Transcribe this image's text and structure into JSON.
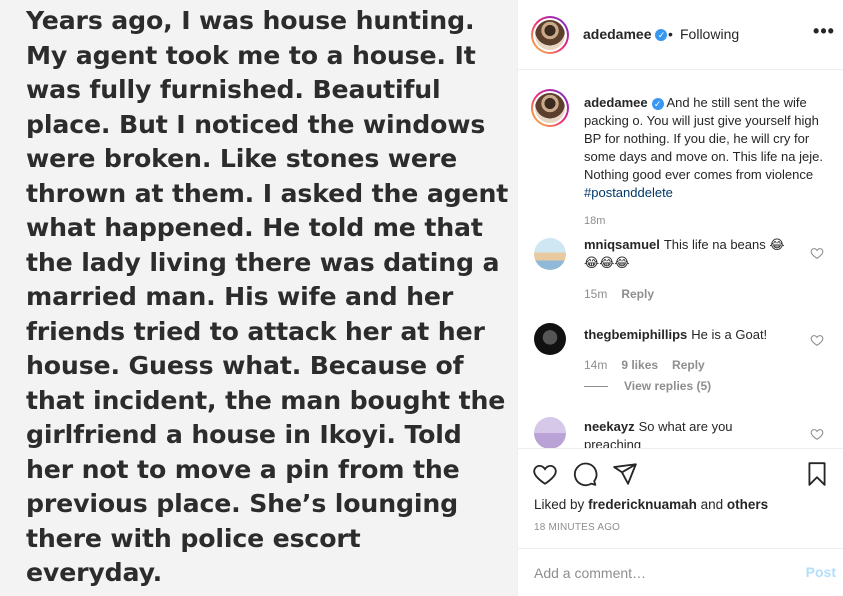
{
  "post_image": {
    "lines": [
      "Years ago, I was house hunting.",
      "My agent took me to a house. It",
      "was fully furnished. Beautiful",
      "place. But I noticed the windows",
      "were broken. Like stones were",
      "thrown at them. I asked the agent",
      "what happened. He told me that",
      "the lady living there was dating a",
      "married man. His wife and her",
      "friends tried to attack her at her",
      "house. Guess what. Because of",
      "that incident, the man bought the",
      "girlfriend a house in Ikoyi. Told",
      "her not to move a pin from the",
      "previous place. She’s lounging",
      "there with police escort",
      "everyday."
    ]
  },
  "header": {
    "username": "adedamee",
    "separator": "•",
    "follow_status": "Following",
    "more_icon": "more-horizontal-icon"
  },
  "caption": {
    "username": "adedamee",
    "text": "And he still sent the wife packing o. You will just give yourself high BP for nothing. If you die, he will cry for some days and move on. This life na jeje. Nothing good ever comes from violence",
    "hashtag": "#postanddelete",
    "time": "18m"
  },
  "comments": [
    {
      "username": "mniqsamuel",
      "text": "This life na beans 😂",
      "text_line2": "😂😂😂",
      "time": "15m",
      "likes": "",
      "reply": "Reply"
    },
    {
      "username": "thegbemiphillips",
      "text": "He is a Goat!",
      "time": "14m",
      "likes": "9 likes",
      "reply": "Reply",
      "view_replies": "View replies (5)"
    },
    {
      "username": "neekayz",
      "text": "So what are you",
      "text_line2": "preaching"
    }
  ],
  "actions": {
    "like_icon": "heart-icon",
    "comment_icon": "comment-icon",
    "share_icon": "send-icon",
    "save_icon": "bookmark-icon",
    "liked_by_prefix": "Liked by",
    "liked_by_user": "fredericknuamah",
    "liked_by_and": "and",
    "liked_by_others": "others",
    "time": "18 MINUTES AGO"
  },
  "add_comment": {
    "placeholder": "Add a comment…",
    "post_label": "Post"
  },
  "colors": {
    "verified": "#3897f0",
    "post_button_disabled": "#b2dffc",
    "hashtag": "#00376b",
    "muted": "#8e8e8e"
  }
}
